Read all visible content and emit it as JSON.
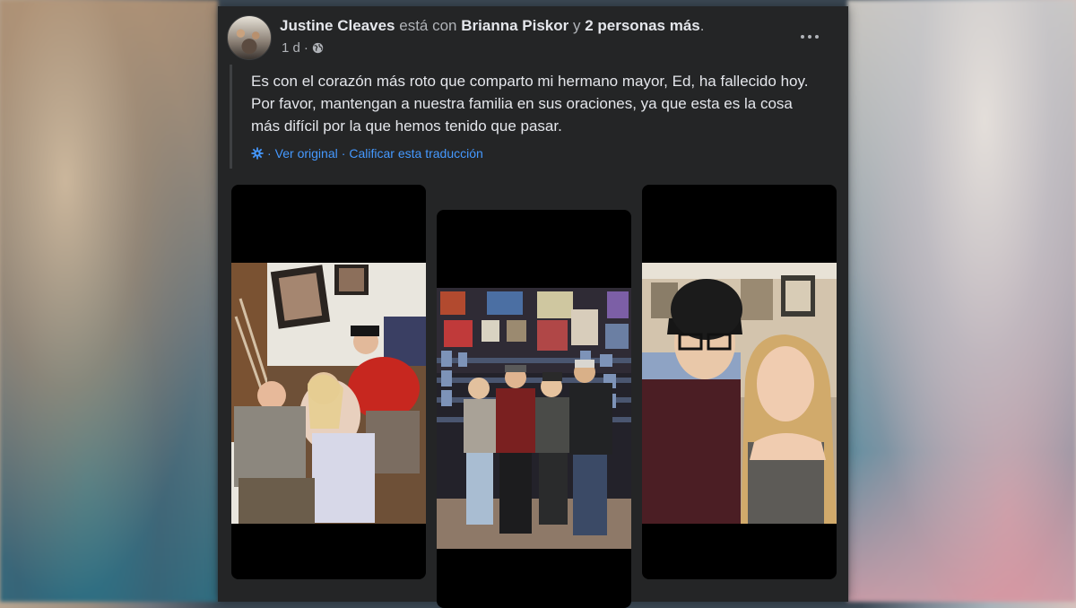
{
  "post": {
    "author": "Justine Cleaves",
    "with_text": "está con",
    "tagged_person": "Brianna Piskor",
    "and_text": "y",
    "others": "2 personas más",
    "period": ".",
    "time": "1 d",
    "dot": "·",
    "message": "Es con el corazón más roto que comparto mi hermano mayor, Ed, ha fallecido hoy. Por favor, mantengan a nuestra familia en sus oraciones, ya que esta es la cosa más difícil por la que hemos tenido que pasar.",
    "translation": {
      "sep1": "·",
      "see_original": "Ver original",
      "sep2": "·",
      "rate": "Calificar esta traducción"
    }
  },
  "icons": {
    "more": "more-options-icon",
    "privacy": "globe-icon",
    "translate": "gear-icon"
  },
  "colors": {
    "card_bg": "#242526",
    "link": "#4599ff",
    "text": "#e4e6eb",
    "muted": "#b0b3b8"
  }
}
